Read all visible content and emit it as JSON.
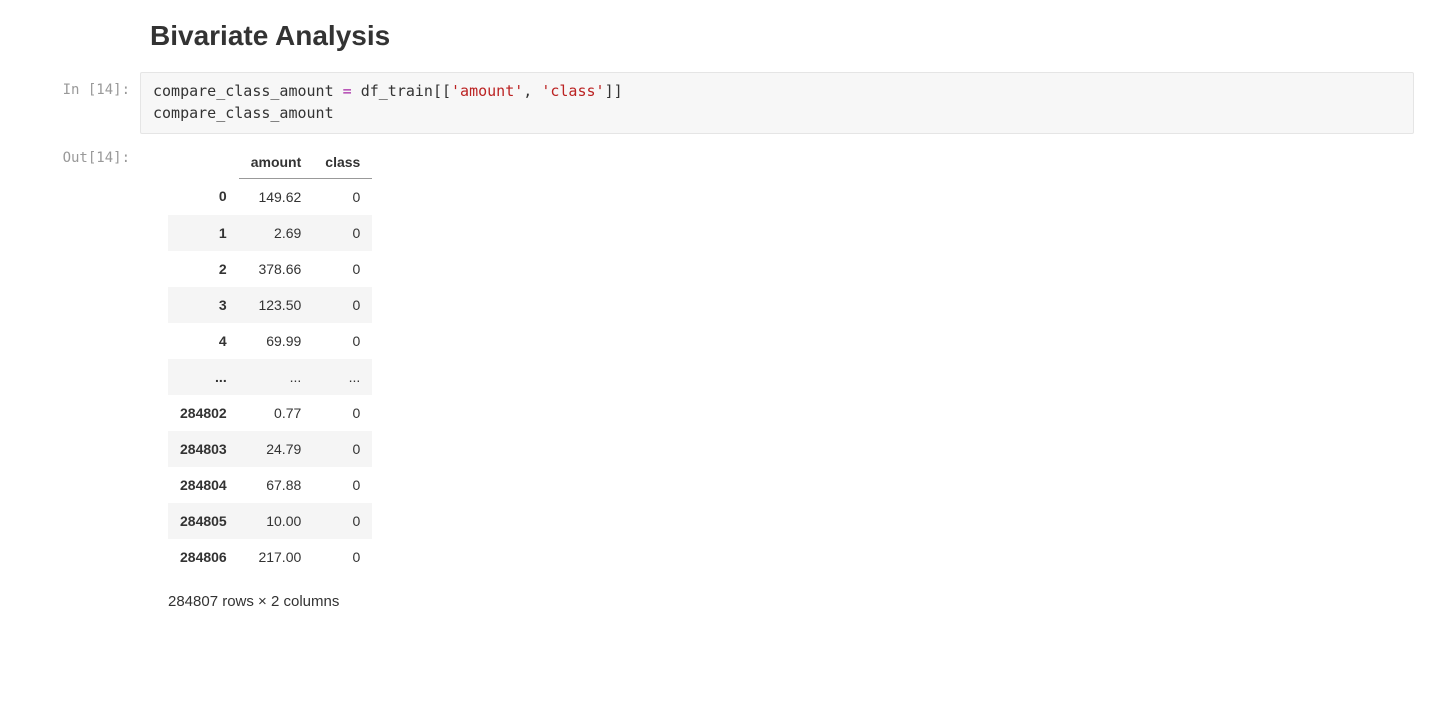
{
  "heading": "Bivariate Analysis",
  "input_prompt": "In [14]:",
  "output_prompt": "Out[14]:",
  "code": {
    "var": "compare_class_amount",
    "eq": " = ",
    "src": "df_train",
    "ob1": "[[",
    "s1": "'amount'",
    "comma": ", ",
    "s2": "'class'",
    "cb1": "]]",
    "line2": "compare_class_amount"
  },
  "table": {
    "columns": [
      "",
      "amount",
      "class"
    ],
    "rows": [
      {
        "idx": "0",
        "amount": "149.62",
        "class": "0"
      },
      {
        "idx": "1",
        "amount": "2.69",
        "class": "0"
      },
      {
        "idx": "2",
        "amount": "378.66",
        "class": "0"
      },
      {
        "idx": "3",
        "amount": "123.50",
        "class": "0"
      },
      {
        "idx": "4",
        "amount": "69.99",
        "class": "0"
      },
      {
        "idx": "...",
        "amount": "...",
        "class": "..."
      },
      {
        "idx": "284802",
        "amount": "0.77",
        "class": "0"
      },
      {
        "idx": "284803",
        "amount": "24.79",
        "class": "0"
      },
      {
        "idx": "284804",
        "amount": "67.88",
        "class": "0"
      },
      {
        "idx": "284805",
        "amount": "10.00",
        "class": "0"
      },
      {
        "idx": "284806",
        "amount": "217.00",
        "class": "0"
      }
    ],
    "footer": "284807 rows × 2 columns"
  }
}
